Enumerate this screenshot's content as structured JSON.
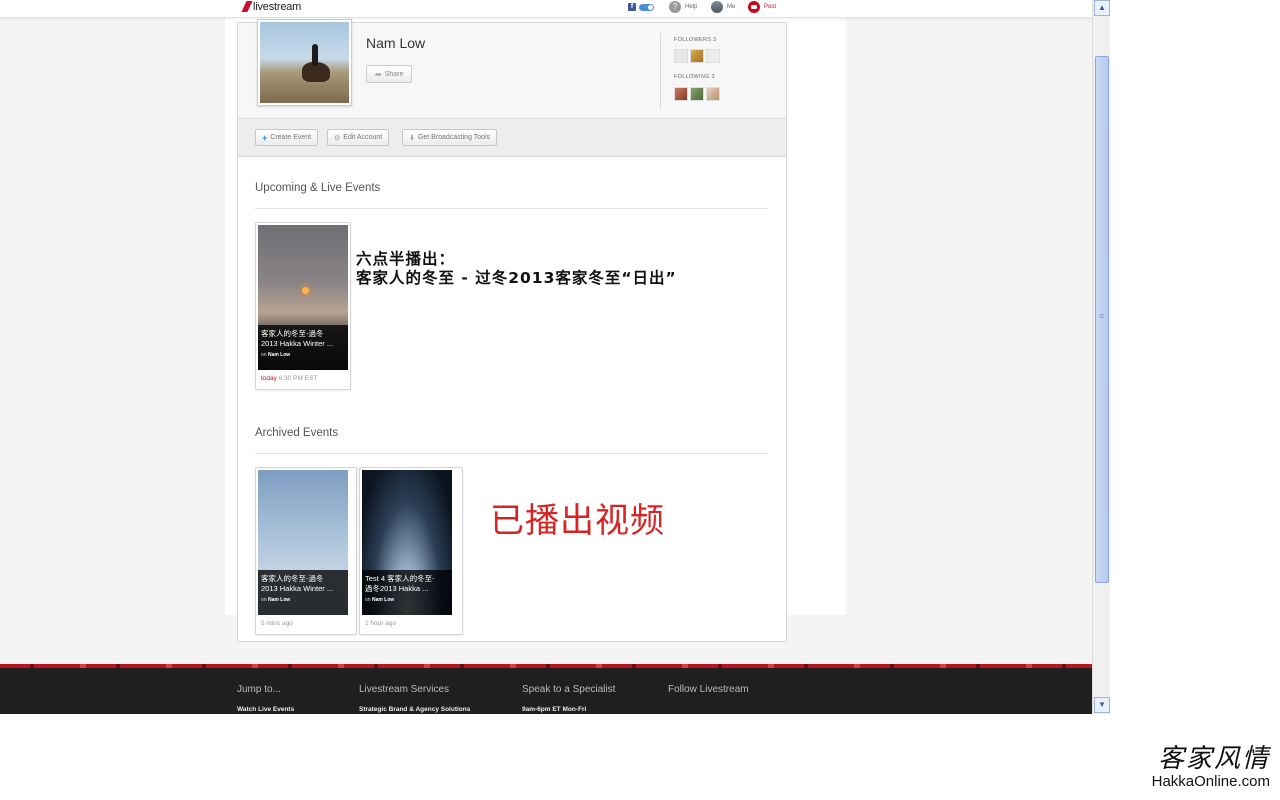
{
  "header": {
    "logo_text": "livestream",
    "help_label": "Help",
    "me_label": "Me",
    "post_label": "Post"
  },
  "profile": {
    "name": "Nam Low",
    "share_label": "Share",
    "followers_label": "FOLLOWERS 3",
    "following_label": "FOLLOWING 3"
  },
  "actions": {
    "create_event": "Create Event",
    "edit_account": "Edit Account",
    "get_tools": "Get Broadcasting Tools"
  },
  "upcoming": {
    "title": "Upcoming & Live Events",
    "event": {
      "title_line1": "客家人的冬至-過冬",
      "title_line2": "2013 Hakka Winter ...",
      "by_prefix": "on",
      "by_name": "Nam Low",
      "time_today": "today",
      "time_rest": "6:30 PM EST"
    },
    "desc_line1": "六点半播出：",
    "desc_line2": "客家人的冬至 - 过冬2013客家冬至“日出”"
  },
  "archived": {
    "title": "Archived Events",
    "events": [
      {
        "title_line1": "客家人的冬至-過冬",
        "title_line2": "2013 Hakka Winter ...",
        "by_prefix": "on",
        "by_name": "Nam Low",
        "time": "5 mins ago"
      },
      {
        "title_line1": "Test 4 客家人的冬至-",
        "title_line2": "過冬2013 Hakka ...",
        "by_prefix": "on",
        "by_name": "Nam Low",
        "time": "1 hour ago"
      }
    ],
    "note": "已播出视频"
  },
  "footer": {
    "col1_head": "Jump to...",
    "col1_link": "Watch Live Events",
    "col2_head": "Livestream Services",
    "col2_link": "Strategic Brand & Agency Solutions",
    "col3_head": "Speak to a Specialist",
    "col3_link": "9am-6pm ET Mon-Fri",
    "col4_head": "Follow Livestream"
  },
  "watermark": {
    "cn": "客家风情",
    "en": "HakkaOnline.com"
  },
  "colors": {
    "brand_red": "#c8102e",
    "scroll_blue": "#b6c9ef",
    "note_red": "#d62424"
  }
}
